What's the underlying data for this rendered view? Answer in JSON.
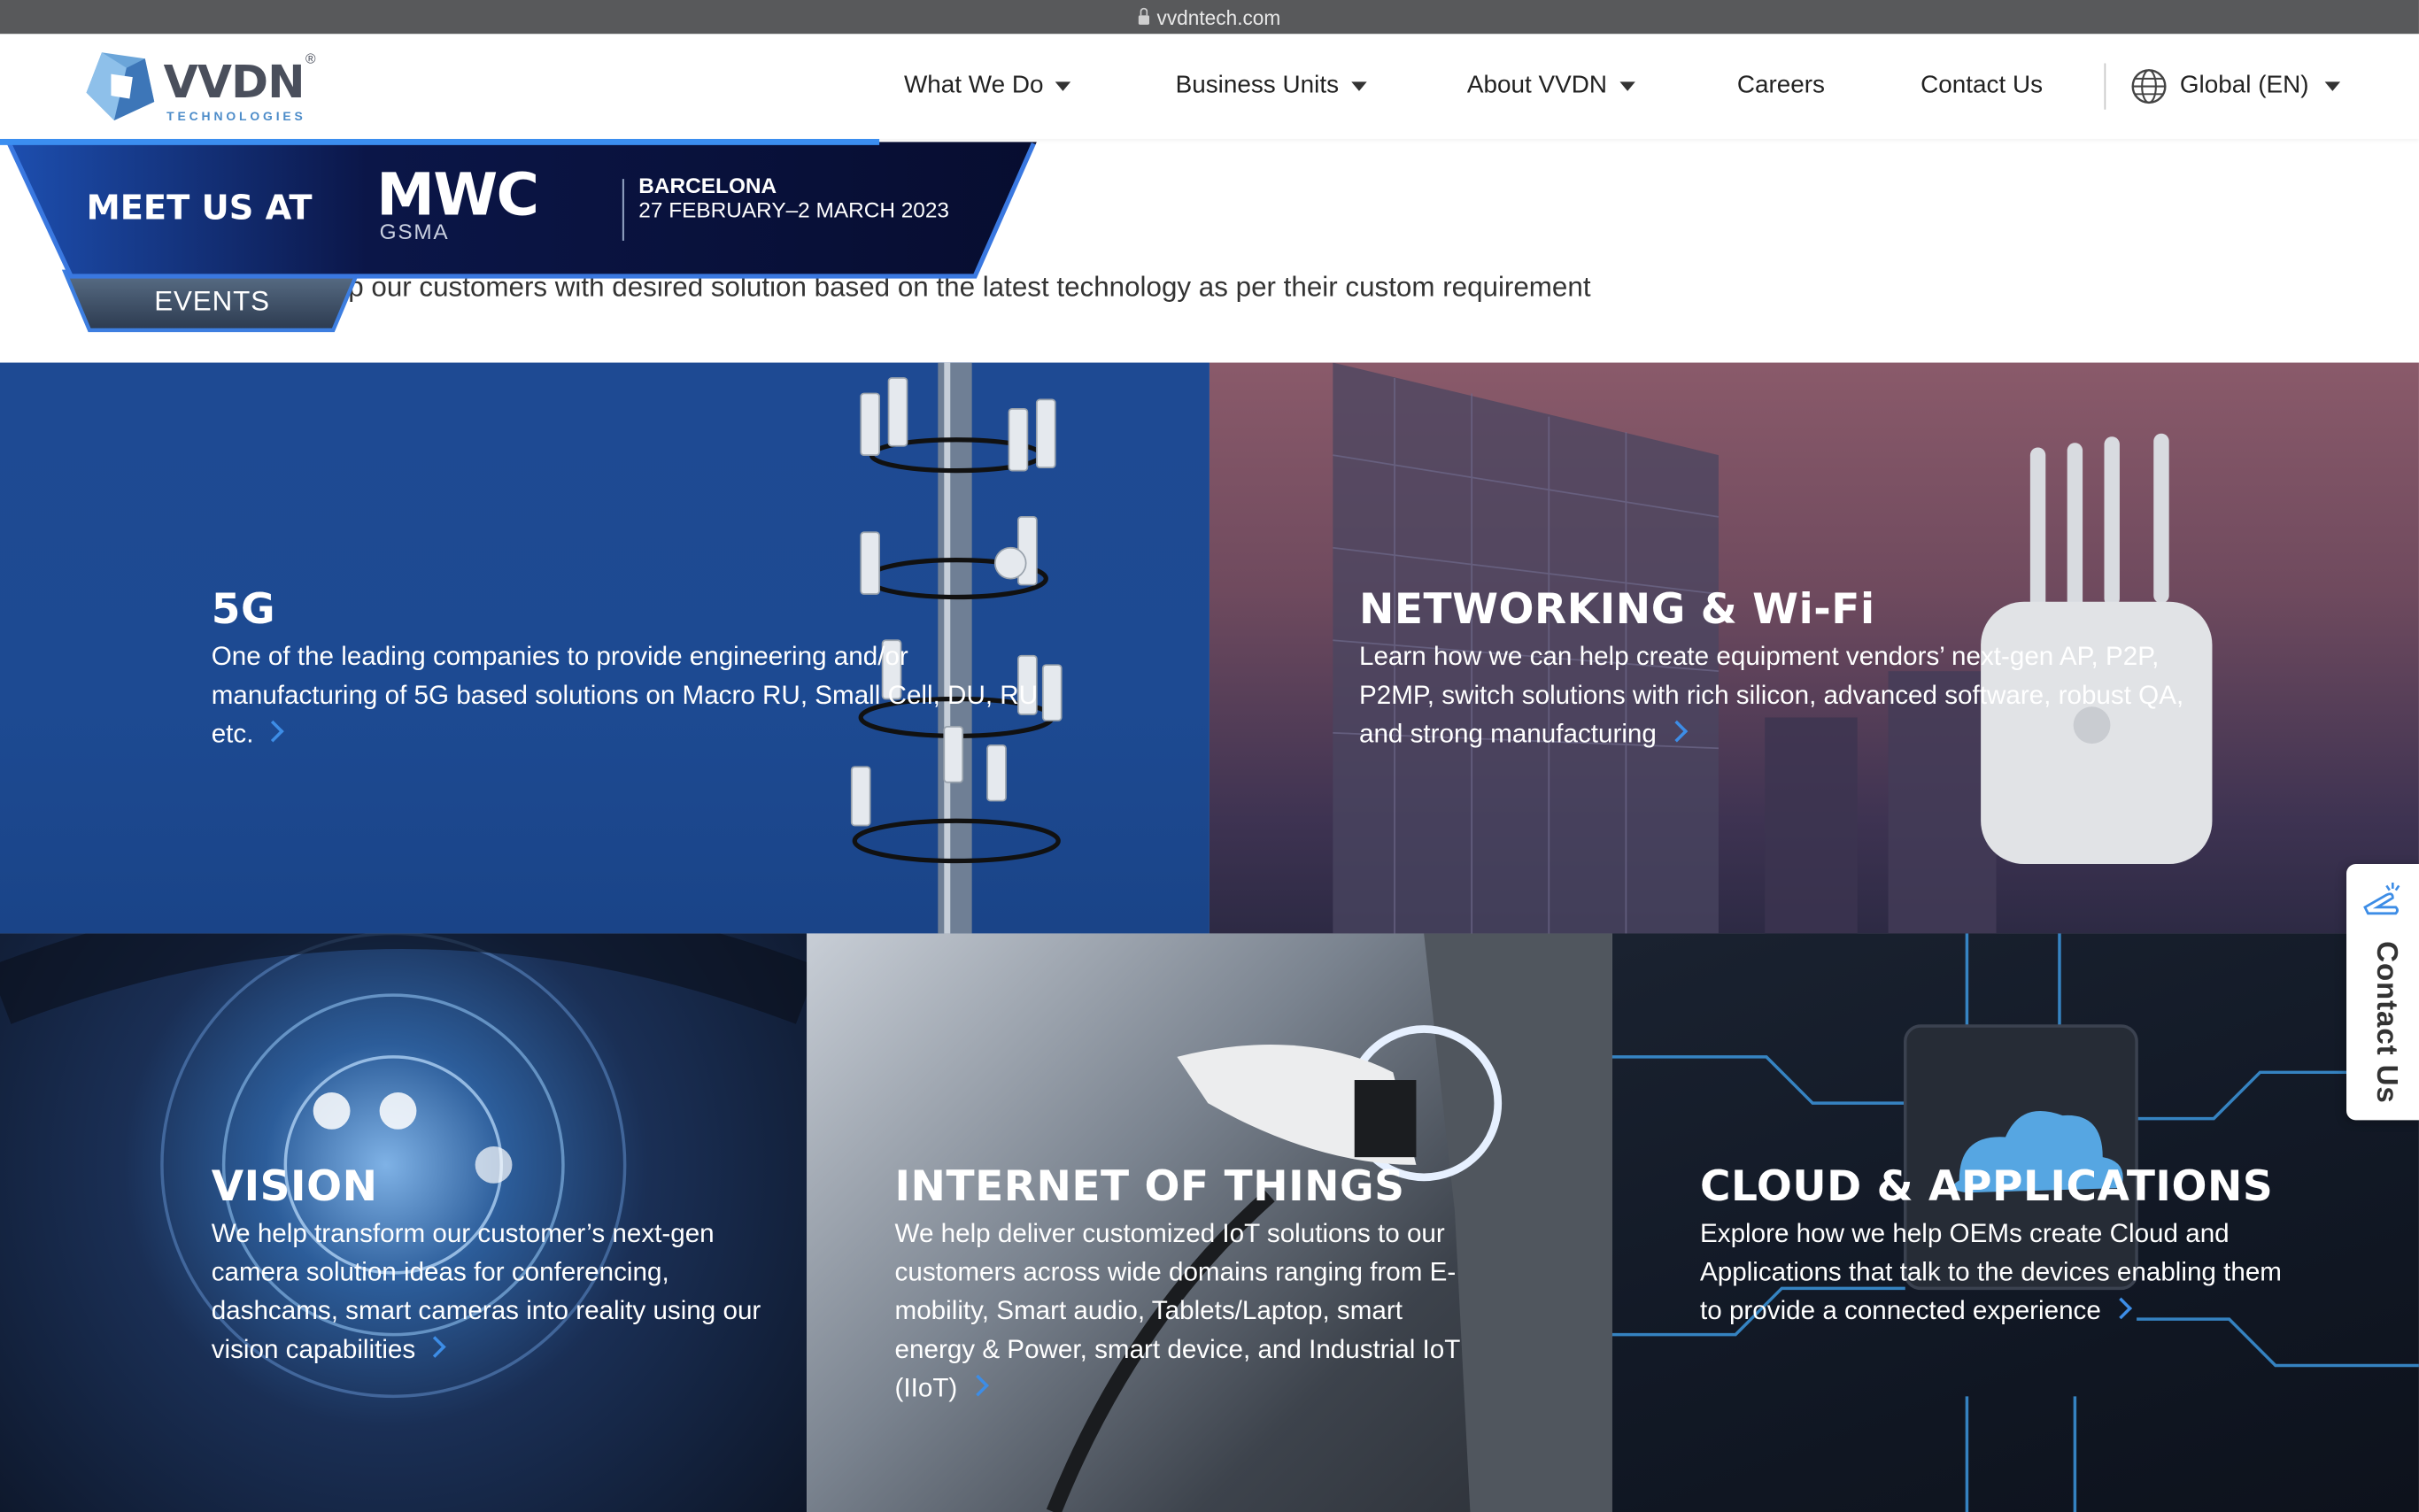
{
  "browser": {
    "url": "vvdntech.com"
  },
  "header": {
    "logo_text": "VVDN",
    "logo_reg": "®",
    "logo_sub": "TECHNOLOGIES",
    "nav": [
      {
        "label": "What We Do",
        "dropdown": true
      },
      {
        "label": "Business Units",
        "dropdown": true
      },
      {
        "label": "About VVDN",
        "dropdown": true
      },
      {
        "label": "Careers",
        "dropdown": false
      },
      {
        "label": "Contact Us",
        "dropdown": false
      }
    ],
    "language": {
      "label": "Global (EN)",
      "icon": "globe-icon"
    }
  },
  "banner": {
    "meet": "MEET US AT",
    "event": "MWC",
    "org": "GSMA",
    "city": "BARCELONA",
    "dates": "27 FEBRUARY–2 MARCH 2023",
    "tab": "EVENTS"
  },
  "intro": "We help our customers with desired solution based on the latest technology as per their custom requirement",
  "tiles": [
    {
      "title": "5G",
      "text": "One of the leading companies to provide engineering and/or manufacturing of 5G based solutions on Macro RU, Small Cell, DU, RU etc."
    },
    {
      "title": "NETWORKING & Wi-Fi",
      "text": "Learn how we can help create equipment vendors’ next-gen AP, P2P, P2MP, switch solutions with rich silicon, advanced software, robust QA, and strong manufacturing"
    },
    {
      "title": "VISION",
      "text": "We help transform our customer’s next-gen camera solution ideas for conferencing, dashcams, smart cameras into reality using our vision capabilities"
    },
    {
      "title": "INTERNET OF THINGS",
      "text": "We help deliver customized IoT solutions to our customers across wide domains ranging from E-mobility, Smart audio, Tablets/Laptop, smart energy & Power, smart device, and Industrial IoT (IIoT)"
    },
    {
      "title": "CLOUD & APPLICATIONS",
      "text": "Explore how we help OEMs create Cloud and Applications that talk to the devices enabling them to provide a connected experience"
    }
  ],
  "contact_tab": {
    "label": "Contact Us"
  },
  "colors": {
    "accent": "#3d8de6",
    "banner_navy": "#0d1440",
    "nav_text": "#333333"
  }
}
